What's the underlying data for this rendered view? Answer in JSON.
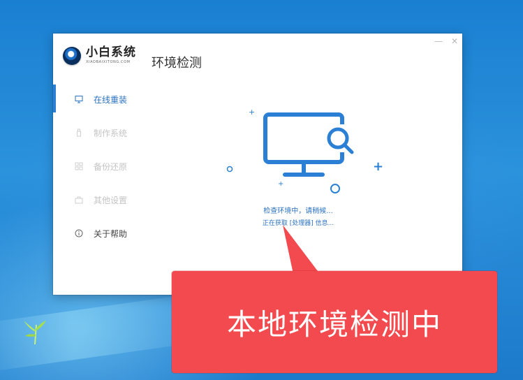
{
  "window": {
    "logo_cn": "小白系统",
    "logo_en": "XIAOBAIXITONG.COM",
    "title": "环境检测",
    "minimize_glyph": "—",
    "close_glyph": "✕"
  },
  "sidebar": {
    "items": [
      {
        "label": "在线重装",
        "icon": "monitor-icon",
        "state": "active"
      },
      {
        "label": "制作系统",
        "icon": "usb-icon",
        "state": "disabled"
      },
      {
        "label": "备份还原",
        "icon": "backup-icon",
        "state": "disabled"
      },
      {
        "label": "其他设置",
        "icon": "settings-box-icon",
        "state": "disabled"
      },
      {
        "label": "关于帮助",
        "icon": "info-icon",
        "state": "normal"
      }
    ]
  },
  "main": {
    "status_primary": "检查环境中，请稍候...",
    "status_secondary": "正在获取 [处理器] 信息...",
    "illustration_icon": "monitor-search-icon"
  },
  "callout": {
    "text": "本地环境检测中"
  },
  "colors": {
    "accent": "#2b7fd4",
    "callout": "#f24a4e",
    "desktop": "#2386d6"
  }
}
